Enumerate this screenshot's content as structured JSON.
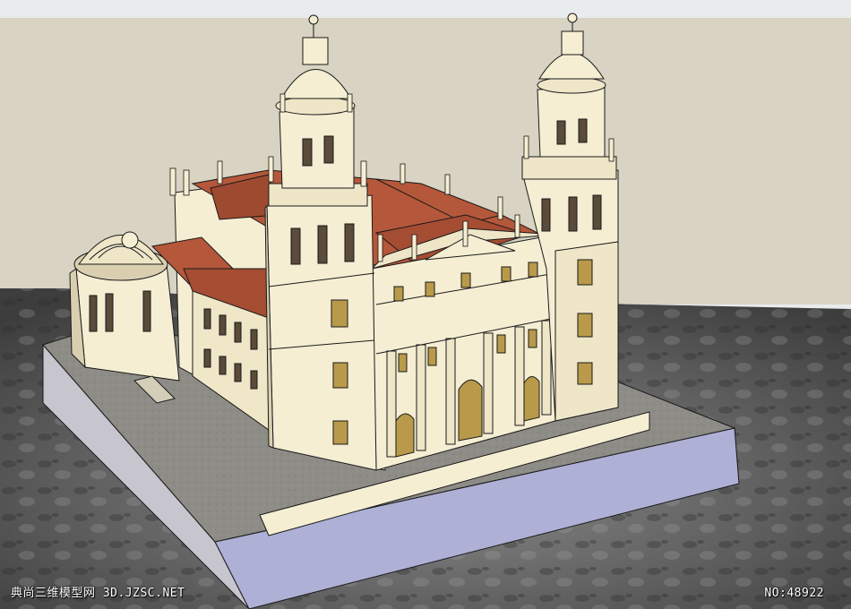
{
  "viewport": {
    "top_band_color": "#e9ecec",
    "sky_color": "#d8d3c2",
    "ground_color": "#6b6b6b"
  },
  "model": {
    "wall_color": "#f5eed3",
    "wall_shade": "#d9cfb0",
    "roof_color": "#b5573a",
    "plaza_color": "#8f8d88",
    "base_side_color": "#aeb0d6",
    "door_color": "#b89a4a",
    "outline_color": "#1a1a1a"
  },
  "watermark": {
    "site": "典尚三维模型网 3D.JZSC.NET",
    "number": "NO:48922"
  }
}
